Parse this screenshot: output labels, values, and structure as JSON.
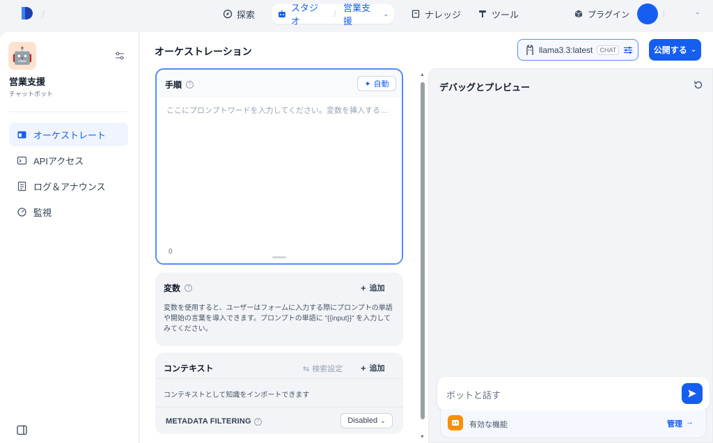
{
  "topbar": {
    "nav": {
      "explore": "探索",
      "studio": "スタジオ",
      "current_app": "営業支援",
      "knowledge": "ナレッジ",
      "tools": "ツール",
      "plugins": "プラグイン"
    },
    "colors": {
      "accent": "#155eef"
    }
  },
  "sidebar": {
    "app_name": "営業支援",
    "app_type": "チャットボット",
    "items": [
      {
        "label": "オーケストレート",
        "icon": "layout-icon",
        "active": true
      },
      {
        "label": "APIアクセス",
        "icon": "terminal-icon",
        "active": false
      },
      {
        "label": "ログ＆アナウンス",
        "icon": "file-list-icon",
        "active": false
      },
      {
        "label": "監視",
        "icon": "dashboard-icon",
        "active": false
      }
    ]
  },
  "main": {
    "title": "オーケストレーション",
    "model": {
      "name": "llama3.3:latest",
      "mode": "CHAT"
    },
    "publish_label": "公開する",
    "prompt": {
      "title": "手順",
      "auto_label": "自動",
      "placeholder": "ここにプロンプトワードを入力してください。変数を挿入するには「{」を…",
      "char_count": "0"
    },
    "variables": {
      "title": "変数",
      "add_label": "追加",
      "description": "変数を使用すると、ユーザーはフォームに入力する際にプロンプトの単語や開始の言葉を導入できます。プロンプトの単語に \"{{input}}\" を入力してみてください。"
    },
    "context": {
      "title": "コンテキスト",
      "search_settings_label": "検索設定",
      "add_label": "追加",
      "description": "コンテキストとして知識をインポートできます",
      "metadata_label": "METADATA FILTERING",
      "metadata_value": "Disabled"
    }
  },
  "debug": {
    "title": "デバッグとプレビュー",
    "input_placeholder": "ボットと話す",
    "features_label": "有効な機能",
    "manage_label": "管理"
  }
}
